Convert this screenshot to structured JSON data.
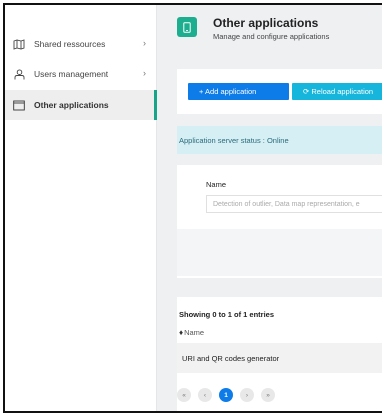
{
  "sidebar": {
    "items": [
      {
        "label": "Shared ressources",
        "icon": "map-icon",
        "chevron": "›"
      },
      {
        "label": "Users management",
        "icon": "user-icon",
        "chevron": "›"
      },
      {
        "label": "Other applications",
        "icon": "window-icon",
        "chevron": ""
      }
    ],
    "accent": "#17a589"
  },
  "header": {
    "title": "Other applications",
    "subtitle": "Manage and configure applications",
    "icon": "tablet-icon"
  },
  "toolbar": {
    "add_label": "+ Add application",
    "reload_label": "⟳ Reload application",
    "primary_color": "#0d7be8",
    "info_color": "#16b6dc"
  },
  "status": {
    "text": "Application server status : Online"
  },
  "filter": {
    "name_label": "Name",
    "name_placeholder": "Detection of outlier, Data map representation, e"
  },
  "table": {
    "showing": "Showing 0 to 1 of 1 entries",
    "column_name": "Name",
    "sort_icon": "♦",
    "rows": [
      {
        "name": "URI and QR codes generator"
      }
    ]
  },
  "pagination": {
    "first": "«",
    "prev": "‹",
    "current": "1",
    "next": "›",
    "last": "»"
  }
}
